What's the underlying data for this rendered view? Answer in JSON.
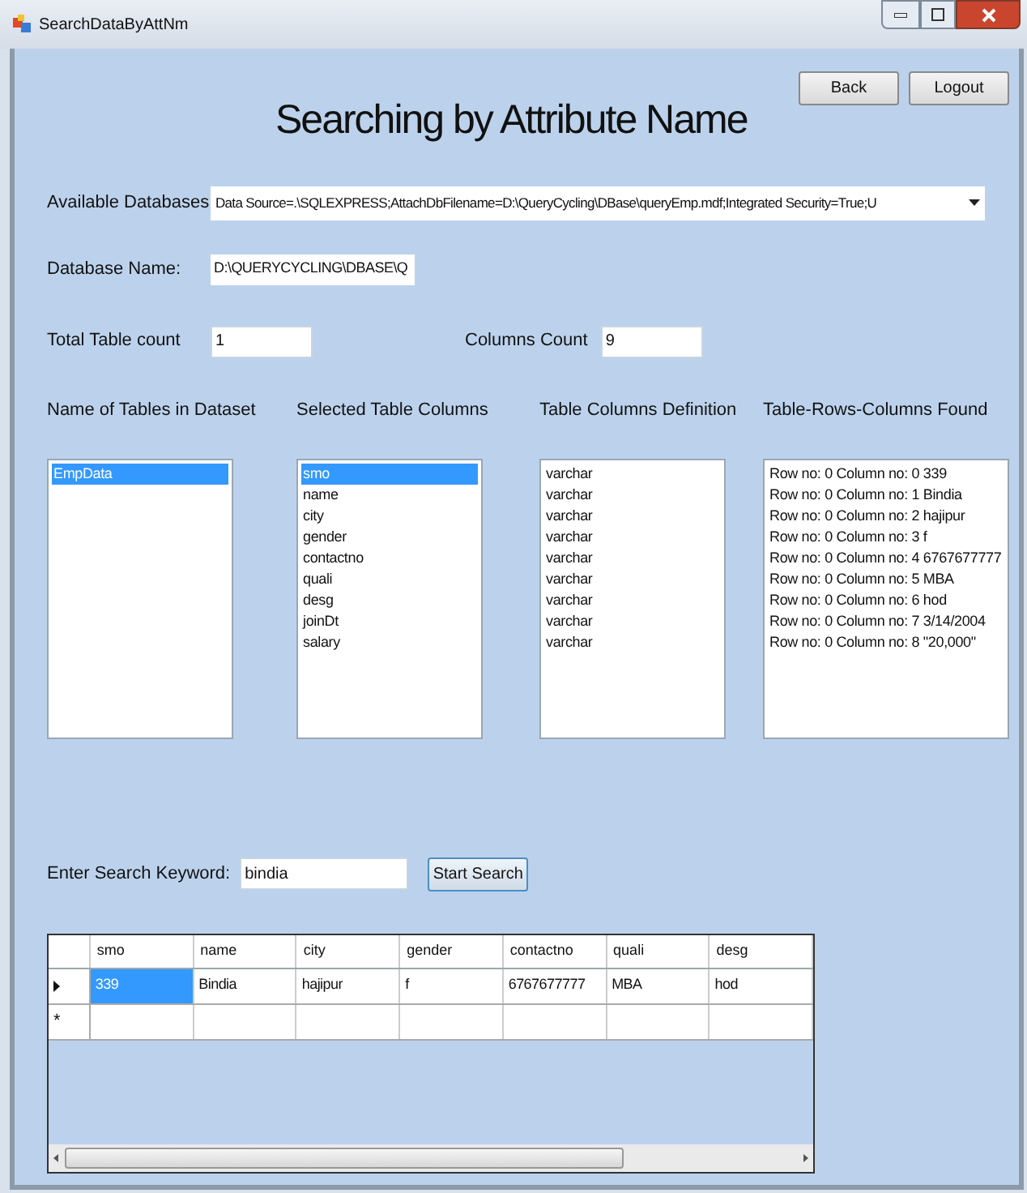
{
  "window": {
    "title": "SearchDataByAttNm"
  },
  "heading": "Searching by Attribute Name",
  "buttons": [
    {
      "label": "Back"
    },
    {
      "label": "Logout"
    }
  ],
  "available_databases": {
    "label": "Available Databases",
    "value": "Data Source=.\\SQLEXPRESS;AttachDbFilename=D:\\QueryCycling\\DBase\\queryEmp.mdf;Integrated Security=True;U"
  },
  "database_name": {
    "label": "Database Name:",
    "value": "D:\\QUERYCYCLING\\DBASE\\Q"
  },
  "total_table_count": {
    "label": "Total Table count",
    "value": "1"
  },
  "columns_count": {
    "label": "Columns Count",
    "value": "9"
  },
  "lists": [
    {
      "label": "Name of Tables in Dataset",
      "items": [
        {
          "text": "EmpData",
          "selected": true
        }
      ]
    },
    {
      "label": "Selected Table Columns",
      "items": [
        {
          "text": "smo",
          "selected": true
        },
        {
          "text": "name",
          "selected": false
        },
        {
          "text": "city",
          "selected": false
        },
        {
          "text": "gender",
          "selected": false
        },
        {
          "text": "contactno",
          "selected": false
        },
        {
          "text": "quali",
          "selected": false
        },
        {
          "text": "desg",
          "selected": false
        },
        {
          "text": "joinDt",
          "selected": false
        },
        {
          "text": "salary",
          "selected": false
        }
      ]
    },
    {
      "label": "Table Columns Definition",
      "items": [
        {
          "text": "varchar",
          "selected": false
        },
        {
          "text": "varchar",
          "selected": false
        },
        {
          "text": "varchar",
          "selected": false
        },
        {
          "text": "varchar",
          "selected": false
        },
        {
          "text": "varchar",
          "selected": false
        },
        {
          "text": "varchar",
          "selected": false
        },
        {
          "text": "varchar",
          "selected": false
        },
        {
          "text": "varchar",
          "selected": false
        },
        {
          "text": "varchar",
          "selected": false
        }
      ]
    },
    {
      "label": "Table-Rows-Columns Found",
      "items": [
        {
          "text": "Row no: 0 Column no: 0 339",
          "selected": false
        },
        {
          "text": "Row no: 0 Column no: 1 Bindia",
          "selected": false
        },
        {
          "text": "Row no: 0 Column no: 2 hajipur",
          "selected": false
        },
        {
          "text": "Row no: 0 Column no: 3 f",
          "selected": false
        },
        {
          "text": "Row no: 0 Column no: 4 6767677777",
          "selected": false
        },
        {
          "text": "Row no: 0 Column no: 5 MBA",
          "selected": false
        },
        {
          "text": "Row no: 0 Column no: 6 hod",
          "selected": false
        },
        {
          "text": "Row no: 0 Column no: 7 3/14/2004",
          "selected": false
        },
        {
          "text": "Row no: 0 Column no: 8 \"20,000\"",
          "selected": false
        }
      ]
    }
  ],
  "search": {
    "label": "Enter Search Keyword:",
    "value": "bindia",
    "button": "Start Search"
  },
  "table": {
    "columns": [
      "smo",
      "name",
      "city",
      "gender",
      "contactno",
      "quali",
      "desg"
    ],
    "rows": [
      {
        "kind": "data",
        "current": true,
        "cells": [
          {
            "text": "339",
            "selected": true
          },
          {
            "text": "Bindia",
            "selected": false
          },
          {
            "text": "hajipur",
            "selected": false
          },
          {
            "text": "f",
            "selected": false
          },
          {
            "text": "6767677777",
            "selected": false
          },
          {
            "text": "MBA",
            "selected": false
          },
          {
            "text": "hod",
            "selected": false
          }
        ]
      },
      {
        "kind": "new",
        "current": false,
        "marker": "*"
      }
    ]
  }
}
